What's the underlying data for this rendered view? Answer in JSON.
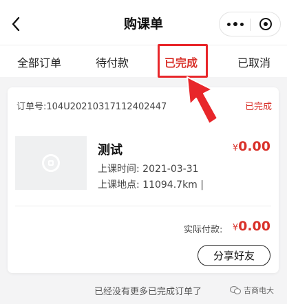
{
  "header": {
    "title": "购课单",
    "back_icon": "chevron-left-icon",
    "more_icon": "more-dots-icon",
    "close_icon": "capsule-close-icon"
  },
  "tabs": [
    {
      "label": "全部订单",
      "active": false
    },
    {
      "label": "待付款",
      "active": false
    },
    {
      "label": "已完成",
      "active": true
    },
    {
      "label": "已取消",
      "active": false
    }
  ],
  "order": {
    "number_label": "订单号:",
    "number": "104U20210317112402447",
    "status": "已完成",
    "course": {
      "title": "测试",
      "price_symbol": "¥",
      "price": "0.00",
      "time_label": "上课时间:",
      "time": "2021-03-31",
      "place_label": "上课地点:",
      "place": "11094.7km |"
    },
    "paid_label": "实际付款:",
    "paid_symbol": "¥",
    "paid_amount": "0.00",
    "share_label": "分享好友"
  },
  "footer": {
    "note": "已经没有更多已完成订单了",
    "watermark": "吉商电大"
  },
  "colors": {
    "accent": "#d9322b",
    "highlight": "#e8262a",
    "background": "#f4f4f5"
  }
}
